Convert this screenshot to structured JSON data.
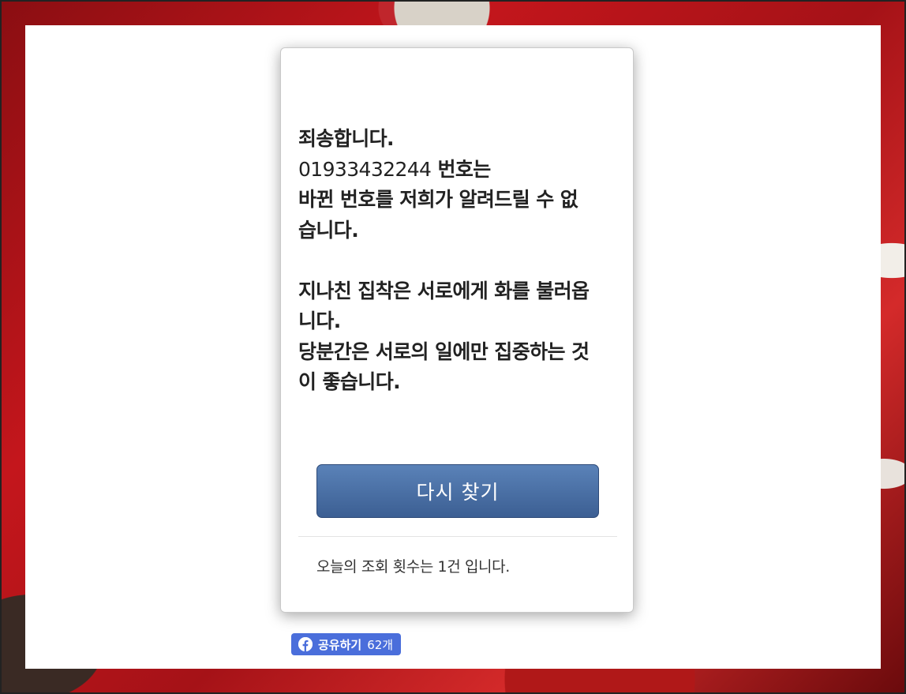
{
  "message": {
    "line1": "죄송합니다.",
    "number": "01933432244",
    "number_suffix": " 번호는",
    "line3": "바뀐 번호를 저희가 알려드릴 수 없",
    "line4": "습니다.",
    "line5": "지나친 집착은 서로에게 화를 불러옵",
    "line6": "니다.",
    "line7": "당분간은 서로의 일에만 집중하는 것",
    "line8": "이 좋습니다."
  },
  "retry_button": {
    "label": "다시 찾기"
  },
  "footer": {
    "view_count_text": "오늘의 조회 횟수는 1건 입니다."
  },
  "share": {
    "label": "공유하기",
    "count": "62개",
    "icon": "facebook-icon"
  },
  "colors": {
    "button": "#4a6fa3",
    "share": "#4a6edb",
    "background": "#c4161c"
  }
}
